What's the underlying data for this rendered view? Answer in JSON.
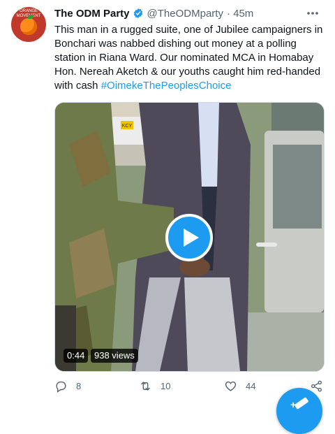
{
  "tweet": {
    "author_name": "The ODM Party",
    "handle": "@TheODMparty",
    "time": "· 45m",
    "avatar_text": "ORANGE MOVEMENT",
    "text_main": "This man in a rugged suite, one of Jubilee campaigners in Bonchari was nabbed dishing out money at a polling station in Riana Ward. Our nominated MCA in Homabay Hon. Nereah Aketch & our youths caught him red-handed with cash ",
    "hashtag": "#OimekeThePeoplesChoice"
  },
  "video": {
    "duration": "0:44",
    "views": "938 views",
    "plate": "KCY"
  },
  "actions": {
    "replies": "8",
    "retweets": "10",
    "likes": "44"
  },
  "icons": {
    "verified": "verified-badge-icon",
    "more": "more-dots-icon",
    "reply": "reply-icon",
    "retweet": "retweet-icon",
    "like": "heart-icon",
    "share": "share-icon",
    "play": "play-icon",
    "compose": "compose-tweet-icon"
  },
  "colors": {
    "accent": "#1d9bf0",
    "text": "#0f1419",
    "muted": "#536471"
  }
}
